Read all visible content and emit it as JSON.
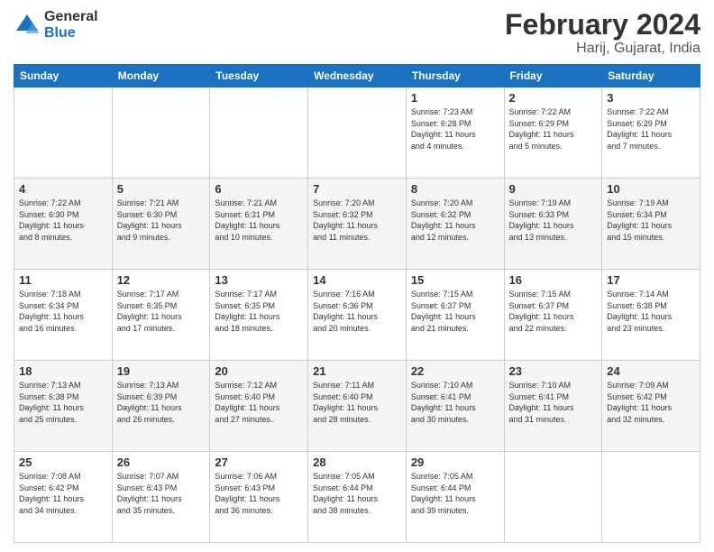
{
  "header": {
    "logo_general": "General",
    "logo_blue": "Blue",
    "title": "February 2024",
    "subtitle": "Harij, Gujarat, India"
  },
  "weekdays": [
    "Sunday",
    "Monday",
    "Tuesday",
    "Wednesday",
    "Thursday",
    "Friday",
    "Saturday"
  ],
  "weeks": [
    [
      {
        "day": "",
        "info": ""
      },
      {
        "day": "",
        "info": ""
      },
      {
        "day": "",
        "info": ""
      },
      {
        "day": "",
        "info": ""
      },
      {
        "day": "1",
        "info": "Sunrise: 7:23 AM\nSunset: 6:28 PM\nDaylight: 11 hours\nand 4 minutes."
      },
      {
        "day": "2",
        "info": "Sunrise: 7:22 AM\nSunset: 6:29 PM\nDaylight: 11 hours\nand 5 minutes."
      },
      {
        "day": "3",
        "info": "Sunrise: 7:22 AM\nSunset: 6:29 PM\nDaylight: 11 hours\nand 7 minutes."
      }
    ],
    [
      {
        "day": "4",
        "info": "Sunrise: 7:22 AM\nSunset: 6:30 PM\nDaylight: 11 hours\nand 8 minutes."
      },
      {
        "day": "5",
        "info": "Sunrise: 7:21 AM\nSunset: 6:30 PM\nDaylight: 11 hours\nand 9 minutes."
      },
      {
        "day": "6",
        "info": "Sunrise: 7:21 AM\nSunset: 6:31 PM\nDaylight: 11 hours\nand 10 minutes."
      },
      {
        "day": "7",
        "info": "Sunrise: 7:20 AM\nSunset: 6:32 PM\nDaylight: 11 hours\nand 11 minutes."
      },
      {
        "day": "8",
        "info": "Sunrise: 7:20 AM\nSunset: 6:32 PM\nDaylight: 11 hours\nand 12 minutes."
      },
      {
        "day": "9",
        "info": "Sunrise: 7:19 AM\nSunset: 6:33 PM\nDaylight: 11 hours\nand 13 minutes."
      },
      {
        "day": "10",
        "info": "Sunrise: 7:19 AM\nSunset: 6:34 PM\nDaylight: 11 hours\nand 15 minutes."
      }
    ],
    [
      {
        "day": "11",
        "info": "Sunrise: 7:18 AM\nSunset: 6:34 PM\nDaylight: 11 hours\nand 16 minutes."
      },
      {
        "day": "12",
        "info": "Sunrise: 7:17 AM\nSunset: 6:35 PM\nDaylight: 11 hours\nand 17 minutes."
      },
      {
        "day": "13",
        "info": "Sunrise: 7:17 AM\nSunset: 6:35 PM\nDaylight: 11 hours\nand 18 minutes."
      },
      {
        "day": "14",
        "info": "Sunrise: 7:16 AM\nSunset: 6:36 PM\nDaylight: 11 hours\nand 20 minutes."
      },
      {
        "day": "15",
        "info": "Sunrise: 7:15 AM\nSunset: 6:37 PM\nDaylight: 11 hours\nand 21 minutes."
      },
      {
        "day": "16",
        "info": "Sunrise: 7:15 AM\nSunset: 6:37 PM\nDaylight: 11 hours\nand 22 minutes."
      },
      {
        "day": "17",
        "info": "Sunrise: 7:14 AM\nSunset: 6:38 PM\nDaylight: 11 hours\nand 23 minutes."
      }
    ],
    [
      {
        "day": "18",
        "info": "Sunrise: 7:13 AM\nSunset: 6:38 PM\nDaylight: 11 hours\nand 25 minutes."
      },
      {
        "day": "19",
        "info": "Sunrise: 7:13 AM\nSunset: 6:39 PM\nDaylight: 11 hours\nand 26 minutes."
      },
      {
        "day": "20",
        "info": "Sunrise: 7:12 AM\nSunset: 6:40 PM\nDaylight: 11 hours\nand 27 minutes."
      },
      {
        "day": "21",
        "info": "Sunrise: 7:11 AM\nSunset: 6:40 PM\nDaylight: 11 hours\nand 28 minutes."
      },
      {
        "day": "22",
        "info": "Sunrise: 7:10 AM\nSunset: 6:41 PM\nDaylight: 11 hours\nand 30 minutes."
      },
      {
        "day": "23",
        "info": "Sunrise: 7:10 AM\nSunset: 6:41 PM\nDaylight: 11 hours\nand 31 minutes."
      },
      {
        "day": "24",
        "info": "Sunrise: 7:09 AM\nSunset: 6:42 PM\nDaylight: 11 hours\nand 32 minutes."
      }
    ],
    [
      {
        "day": "25",
        "info": "Sunrise: 7:08 AM\nSunset: 6:42 PM\nDaylight: 11 hours\nand 34 minutes."
      },
      {
        "day": "26",
        "info": "Sunrise: 7:07 AM\nSunset: 6:43 PM\nDaylight: 11 hours\nand 35 minutes."
      },
      {
        "day": "27",
        "info": "Sunrise: 7:06 AM\nSunset: 6:43 PM\nDaylight: 11 hours\nand 36 minutes."
      },
      {
        "day": "28",
        "info": "Sunrise: 7:05 AM\nSunset: 6:44 PM\nDaylight: 11 hours\nand 38 minutes."
      },
      {
        "day": "29",
        "info": "Sunrise: 7:05 AM\nSunset: 6:44 PM\nDaylight: 11 hours\nand 39 minutes."
      },
      {
        "day": "",
        "info": ""
      },
      {
        "day": "",
        "info": ""
      }
    ]
  ]
}
